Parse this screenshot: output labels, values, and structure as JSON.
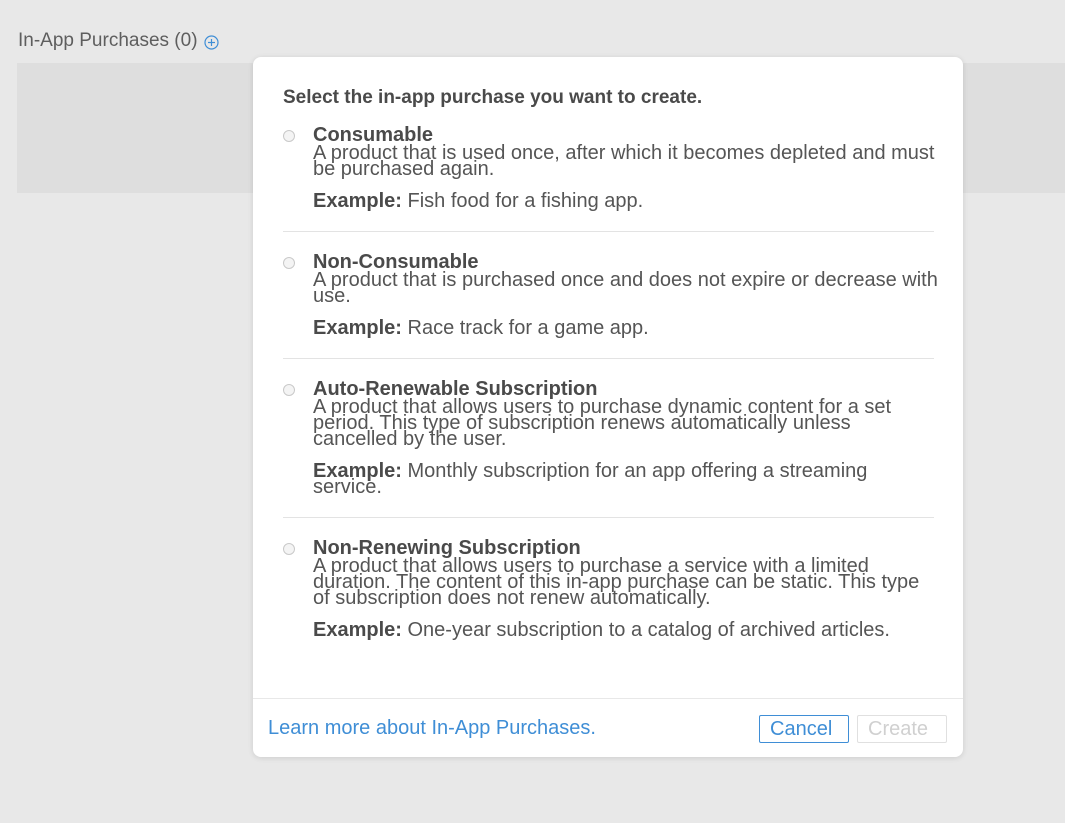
{
  "header": {
    "title": "In-App Purchases (0)",
    "add_icon": "add-circle-icon"
  },
  "modal": {
    "title": "Select the in-app purchase you want to create.",
    "example_label": "Example:",
    "options": [
      {
        "title": "Consumable",
        "description": "A product that is used once, after which it becomes depleted and must be purchased again.",
        "example": "Fish food for a fishing app."
      },
      {
        "title": "Non-Consumable",
        "description": "A product that is purchased once and does not expire or decrease with use.",
        "example": "Race track for a game app."
      },
      {
        "title": "Auto-Renewable Subscription",
        "description": "A product that allows users to purchase dynamic content for a set period.  This type of subscription renews automatically unless cancelled by the user.",
        "example": "Monthly subscription for an app offering a streaming service."
      },
      {
        "title": "Non-Renewing Subscription",
        "description": "A product that allows users to purchase a service with a limited duration. The content of this in-app purchase can be static. This type of subscription does not renew automatically.",
        "example": "One-year subscription to a catalog of archived articles."
      }
    ],
    "footer": {
      "learn_more": "Learn more about In-App Purchases.",
      "cancel": "Cancel",
      "create": "Create"
    }
  },
  "colors": {
    "link": "#3f8ed6",
    "disabled": "#d0d0d0",
    "background": "#e8e8e8"
  }
}
